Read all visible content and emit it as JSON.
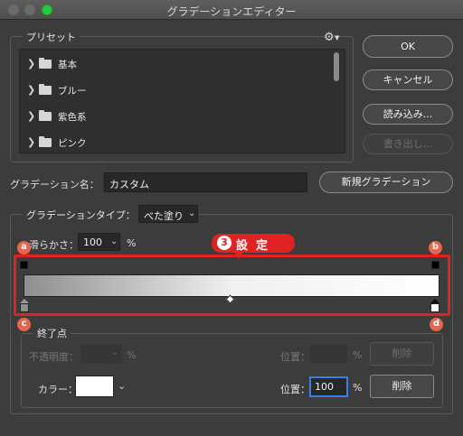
{
  "window": {
    "title": "グラデーションエディター"
  },
  "presets": {
    "title": "プリセット",
    "items": [
      {
        "label": "基本"
      },
      {
        "label": "ブルー"
      },
      {
        "label": "紫色系"
      },
      {
        "label": "ピンク"
      }
    ]
  },
  "buttons": {
    "ok": "OK",
    "cancel": "キャンセル",
    "load": "読み込み...",
    "export": "書き出し...",
    "new_gradient": "新規グラデーション",
    "delete_opacity": "削除",
    "delete_color": "削除"
  },
  "name_field": {
    "label": "グラデーション名：",
    "value": "カスタム"
  },
  "gradient_type": {
    "group_title": "グラデーションタイプ：",
    "selected": "べた塗り",
    "smoothness_label": "滑らかさ：",
    "smoothness_value": "100",
    "smoothness_unit": "%"
  },
  "annotation": {
    "number": "3",
    "text": "設定",
    "markers": [
      "a",
      "b",
      "c",
      "d"
    ]
  },
  "stops": {
    "group_title": "終了点",
    "opacity_label": "不透明度：",
    "opacity_value": "",
    "opacity_unit": "%",
    "opacity_location_label": "位置：",
    "opacity_location_value": "",
    "opacity_location_unit": "%",
    "color_label": "カラー：",
    "color_value": "#ffffff",
    "color_location_label": "位置：",
    "color_location_value": "100",
    "color_location_unit": "%"
  },
  "colors": {
    "annotation_red": "#e02222",
    "marker_orange": "#e8644b",
    "focus_blue": "#3a7ee6",
    "gradient_start": "#8e8e8e",
    "gradient_end": "#ffffff"
  }
}
